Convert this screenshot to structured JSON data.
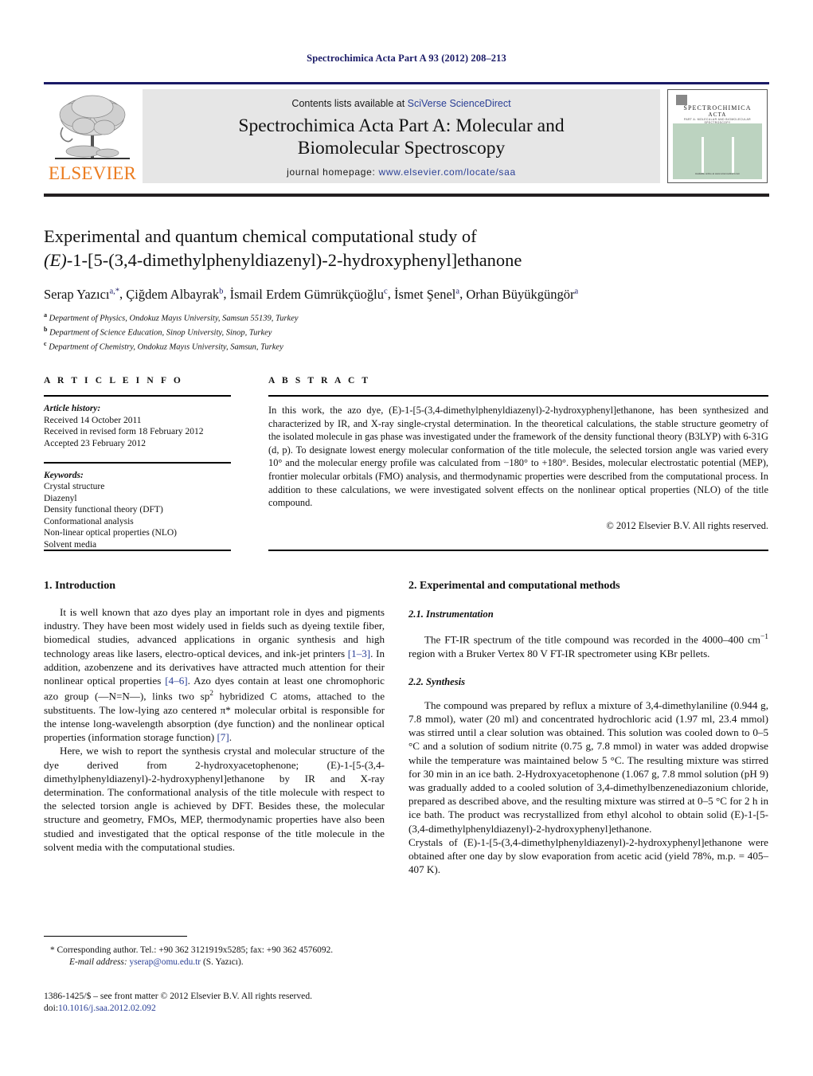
{
  "running_head": "Spectrochimica Acta Part A 93 (2012) 208–213",
  "masthead": {
    "contents_prefix": "Contents lists available at ",
    "sciencedirect": "SciVerse ScienceDirect",
    "journal_title_line1": "Spectrochimica Acta Part A: Molecular and",
    "journal_title_line2": "Biomolecular Spectroscopy",
    "homepage_prefix": "journal homepage: ",
    "homepage_url": "www.elsevier.com/locate/saa",
    "publisher": "ELSEVIER",
    "cover": {
      "line1": "SPECTROCHIMICA",
      "line2": "ACTA",
      "line3": "PART A: MOLECULAR AND BIOMOLECULAR SPECTROSCOPY",
      "footer": "Available online at www.sciencedirect.com"
    }
  },
  "article": {
    "title_line1": "Experimental and quantum chemical computational study of",
    "title_line2": "(E)-1-[5-(3,4-dimethylphenyldiazenyl)-2-hydroxyphenyl]ethanone",
    "authors": "Serap Yazıcı, Çiğdem Albayrak, İsmail Erdem Gümrükçüoğlu, İsmet Şenel, Orhan Büyükgüngör",
    "author_list": [
      {
        "name": "Serap Yazıcı",
        "sup": "a,*"
      },
      {
        "name": "Çiğdem Albayrak",
        "sup": "b"
      },
      {
        "name": "İsmail Erdem Gümrükçüoğlu",
        "sup": "c"
      },
      {
        "name": "İsmet Şenel",
        "sup": "a"
      },
      {
        "name": "Orhan Büyükgüngör",
        "sup": "a"
      }
    ],
    "affiliations": [
      {
        "mark": "a",
        "text": "Department of Physics, Ondokuz Mayıs University, Samsun 55139, Turkey"
      },
      {
        "mark": "b",
        "text": "Department of Science Education, Sinop University, Sinop, Turkey"
      },
      {
        "mark": "c",
        "text": "Department of Chemistry, Ondokuz Mayıs University, Samsun, Turkey"
      }
    ]
  },
  "article_info": {
    "heading": "A R T I C L E    I N F O",
    "history_label": "Article history:",
    "history": [
      "Received 14 October 2011",
      "Received in revised form 18 February 2012",
      "Accepted 23 February 2012"
    ],
    "keywords_label": "Keywords:",
    "keywords": [
      "Crystal structure",
      "Diazenyl",
      "Density functional theory (DFT)",
      "Conformational analysis",
      "Non-linear optical properties (NLO)",
      "Solvent media"
    ]
  },
  "abstract": {
    "heading": "A B S T R A C T",
    "text": "In this work, the azo dye, (E)-1-[5-(3,4-dimethylphenyldiazenyl)-2-hydroxyphenyl]ethanone, has been synthesized and characterized by IR, and X-ray single-crystal determination. In the theoretical calculations, the stable structure geometry of the isolated molecule in gas phase was investigated under the framework of the density functional theory (B3LYP) with 6-31G (d, p). To designate lowest energy molecular conformation of the title molecule, the selected torsion angle was varied every 10° and the molecular energy profile was calculated from −180° to +180°. Besides, molecular electrostatic potential (MEP), frontier molecular orbitals (FMO) analysis, and thermodynamic properties were described from the computational process. In addition to these calculations, we were investigated solvent effects on the nonlinear optical properties (NLO) of the title compound.",
    "copyright": "© 2012 Elsevier B.V. All rights reserved."
  },
  "sections": {
    "intro_heading": "1.  Introduction",
    "intro_p1_a": "It is well known that azo dyes play an important role in dyes and pigments industry. They have been most widely used in fields such as dyeing textile fiber, biomedical studies, advanced applications in organic synthesis and high technology areas like lasers, electro-optical devices, and ink-jet printers ",
    "intro_p1_ref1": "[1–3]",
    "intro_p1_b": ". In addition, azobenzene and its derivatives have attracted much attention for their nonlinear optical properties ",
    "intro_p1_ref2": "[4–6]",
    "intro_p1_c": ". Azo dyes contain at least one chromophoric azo group (—N=N—), links two sp",
    "intro_p1_sup": "2",
    "intro_p1_d": " hybridized C atoms, attached to the substituents. The low-lying azo centered π* molecular orbital is responsible for the intense long-wavelength absorption (dye function) and the nonlinear optical properties (information storage function) ",
    "intro_p1_ref3": "[7]",
    "intro_p1_e": ".",
    "intro_p2": "Here, we wish to report the synthesis crystal and molecular structure of the dye derived from 2-hydroxyacetophenone; (E)-1-[5-(3,4-dimethylphenyldiazenyl)-2-hydroxyphenyl]ethanone by IR and X-ray determination. The conformational analysis of the title molecule with respect to the selected torsion angle is achieved by DFT. Besides these, the molecular structure and geometry, FMOs, MEP, thermodynamic properties have also been studied and investigated that the optical response of the title molecule in the solvent media with the computational studies.",
    "exp_heading": "2.  Experimental and computational methods",
    "instr_heading": "2.1.  Instrumentation",
    "instr_p_a": "The FT-IR spectrum of the title compound was recorded in the 4000–400 cm",
    "instr_p_sup": "−1",
    "instr_p_b": " region with a Bruker Vertex 80 V FT-IR spectrometer using KBr pellets.",
    "synth_heading": "2.2.  Synthesis",
    "synth_p1": "The compound was prepared by reflux a mixture of 3,4-dimethylaniline (0.944 g, 7.8 mmol), water (20 ml) and concentrated hydrochloric acid (1.97 ml, 23.4 mmol) was stirred until a clear solution was obtained. This solution was cooled down to 0–5 °C and a solution of sodium nitrite (0.75 g, 7.8 mmol) in water was added dropwise while the temperature was maintained below 5 °C. The resulting mixture was stirred for 30 min in an ice bath. 2-Hydroxyacetophenone (1.067 g, 7.8 mmol solution (pH 9) was gradually added to a cooled solution of 3,4-dimethylbenzenediazonium chloride, prepared as described above, and the resulting mixture was stirred at 0–5 °C for 2 h in ice bath. The product was recrystallized from ethyl alcohol to obtain solid (E)-1-[5-(3,4-dimethylphenyldiazenyl)-2-hydroxyphenyl]ethanone.",
    "synth_p2": "Crystals of (E)-1-[5-(3,4-dimethylphenyldiazenyl)-2-hydroxyphenyl]ethanone were obtained after one day by slow evaporation from acetic acid (yield 78%, m.p. = 405–407 K)."
  },
  "footnotes": {
    "corresponding": "* Corresponding author. Tel.: +90 362 3121919x5285; fax: +90 362 4576092.",
    "email_label": "E-mail address:",
    "email": "yserap@omu.edu.tr",
    "email_suffix": "(S. Yazıcı).",
    "frontmatter": "1386-1425/$ – see front matter © 2012 Elsevier B.V. All rights reserved.",
    "doi_label": "doi:",
    "doi": "10.1016/j.saa.2012.02.092"
  },
  "colors": {
    "link": "#2a3f96",
    "running_head": "#1a1a66",
    "elsevier_orange": "#eb7c1f",
    "masthead_bg": "#e6e6e6",
    "cover_green": "#bcd3c0",
    "rule": "#231f20"
  }
}
